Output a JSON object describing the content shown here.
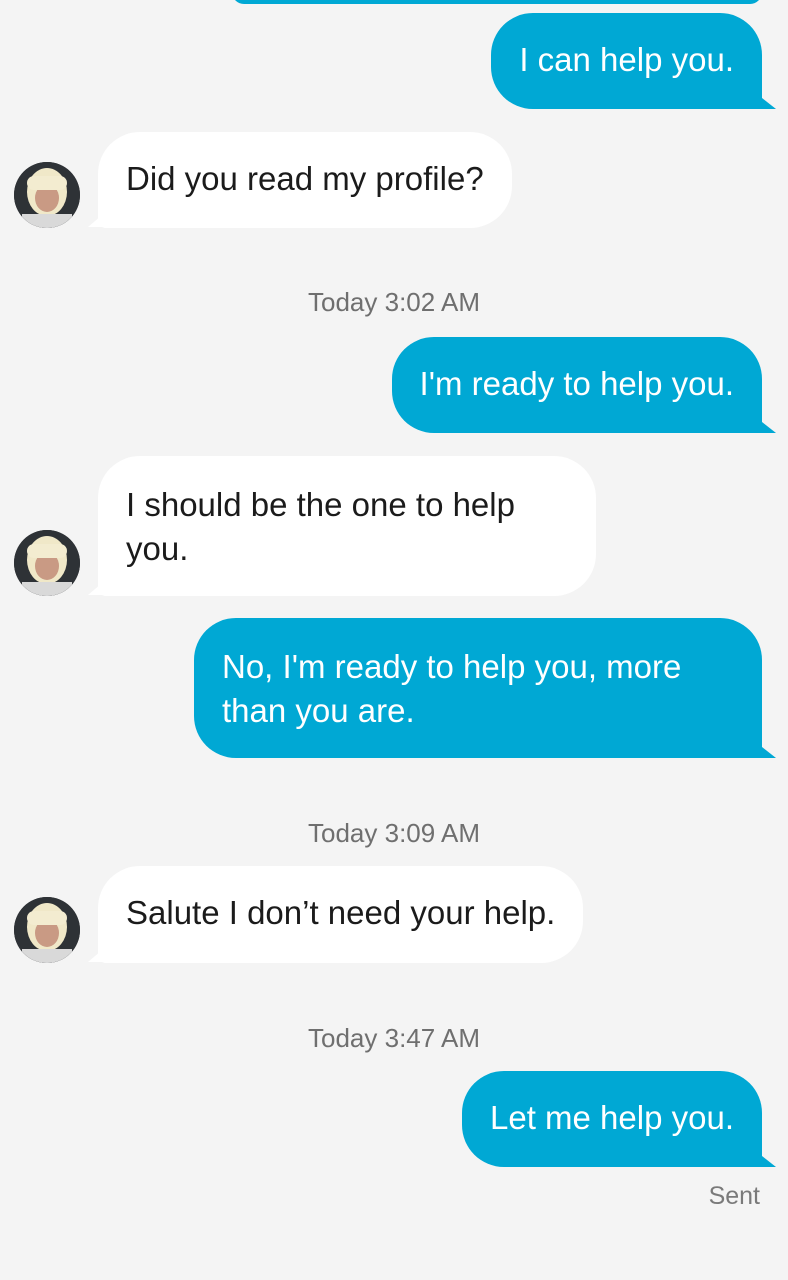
{
  "conversation": {
    "messages": [
      {
        "from": "me",
        "text": "I can help you."
      },
      {
        "from": "them",
        "text": "Did you read my profile?"
      },
      {
        "from": "me",
        "text": "I'm ready to help you."
      },
      {
        "from": "them",
        "text": "I should be the one to help you."
      },
      {
        "from": "me",
        "text": "No, I'm ready to help you, more than you are."
      },
      {
        "from": "them",
        "text": "Salute I don’t need your help."
      },
      {
        "from": "me",
        "text": "Let me help you."
      }
    ],
    "timestamps": [
      "Today 3:02 AM",
      "Today 3:09 AM",
      "Today 3:47 AM"
    ],
    "status": "Sent"
  },
  "colors": {
    "outgoing_bubble": "#00a8d4",
    "incoming_bubble": "#ffffff",
    "background": "#f4f4f4"
  }
}
